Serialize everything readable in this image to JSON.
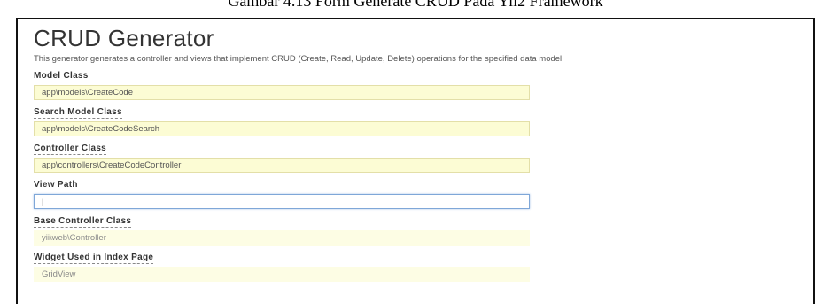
{
  "caption": "Gambar 4.13 Form Generate CRUD Pada Yii2 Framework",
  "generator": {
    "title": "CRUD Generator",
    "description": "This generator generates a controller and views that implement CRUD (Create, Read, Update, Delete) operations for the specified data model."
  },
  "fields": {
    "model_class": {
      "label": "Model Class",
      "value": "app\\models\\CreateCode"
    },
    "search_model_class": {
      "label": "Search Model Class",
      "value": "app\\models\\CreateCodeSearch"
    },
    "controller_class": {
      "label": "Controller Class",
      "value": "app\\controllers\\CreateCodeController"
    },
    "view_path": {
      "label": "View Path",
      "value": "|"
    },
    "base_controller_class": {
      "label": "Base Controller Class",
      "value": "yii\\web\\Controller"
    },
    "index_widget": {
      "label": "Widget Used in Index Page",
      "value": "GridView"
    }
  },
  "colors": {
    "input_background": "#fcfcd4",
    "focus_border": "#7fa7d8"
  }
}
